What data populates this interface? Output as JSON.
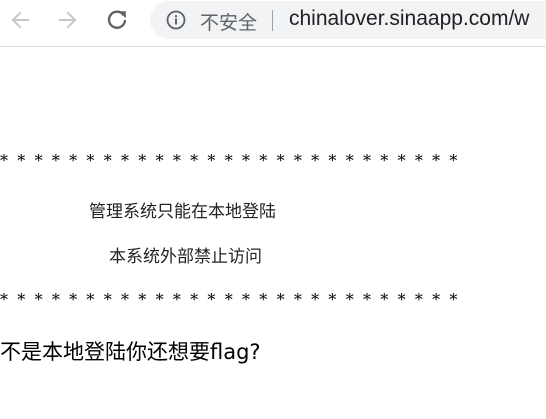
{
  "browser": {
    "security_label": "不安全",
    "url": "chinalover.sinaapp.com/w",
    "icons": {
      "back": "back-arrow-icon",
      "forward": "forward-arrow-icon",
      "reload": "reload-icon",
      "site_info": "info-icon"
    }
  },
  "page": {
    "stars_top": "* * * * * * * * * * * * * * * * * * * * * * * * * * *",
    "notice_line1": "管理系统只能在本地登陆",
    "notice_line2": "本系统外部禁止访问",
    "stars_bottom": "* * * * * * * * * * * * * * * * * * * * * * * * * * *",
    "hint": "不是本地登陆你还想要flag?"
  }
}
